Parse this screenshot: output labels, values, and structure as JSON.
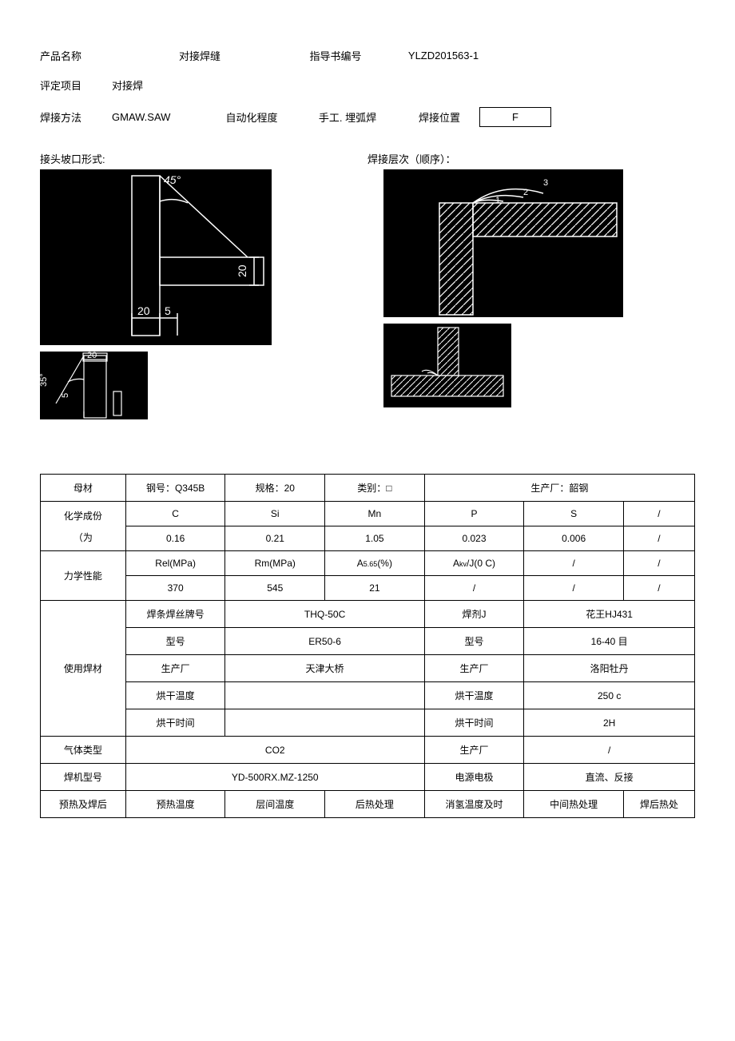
{
  "header": {
    "product_name_label": "产品名称",
    "product_name": "对接焊缝",
    "guide_no_label": "指导书编号",
    "guide_no": "YLZD201563-1",
    "eval_item_label": "评定项目",
    "eval_item": "对接焊",
    "weld_method_label": "焊接方法",
    "weld_method": "GMAW.SAW",
    "automation_label": "自动化程度",
    "automation": "手工. 埋弧焊",
    "weld_position_label": "焊接位置",
    "weld_position": "F"
  },
  "sections": {
    "groove_title": "接头坡口形式:",
    "layer_title": "焊接层次（顺序）："
  },
  "diagram_labels": {
    "angle45": "45°",
    "dim20v": "20",
    "dim20h": "20",
    "dim5": "5",
    "angle35": "35°",
    "small20": "20",
    "small5": "5",
    "pass3": "3",
    "pass2": "2",
    "pass1": "1"
  },
  "table": {
    "base_metal": "母材",
    "steel_grade_label": "钢号：",
    "steel_grade": "Q345B",
    "spec_label": "规格：",
    "spec": "20",
    "category_label": "类别：",
    "category": "□",
    "producer_label_full": "生产厂：韶钢",
    "chem_label": "化学成份",
    "chem_note": "（为",
    "C": "C",
    "Si": "Si",
    "Mn": "Mn",
    "P": "P",
    "S": "S",
    "slash": "/",
    "C_v": "0.16",
    "Si_v": "0.21",
    "Mn_v": "1.05",
    "P_v": "0.023",
    "S_v": "0.006",
    "mech_label": "力学性能",
    "Rel": "Rel(MPa)",
    "Rm": "Rm(MPa)",
    "A": "A",
    "A_sub": "5.65",
    "A_pct": "(%)",
    "Akv": "A",
    "Akv_sub": "kv",
    "Akv_suffix": "/J(0 C)",
    "Rel_v": "370",
    "Rm_v": "545",
    "A_v": "21",
    "material_label": "使用焊材",
    "wire_brand_label": "焊条焊丝牌号",
    "wire_brand": "THQ-50C",
    "flux_label": "焊剂J",
    "flux_brand": "花王HJ431",
    "model_label": "型号",
    "wire_model": "ER50-6",
    "flux_model": "16-40 目",
    "producer_label": "生产厂",
    "wire_producer": "天津大桥",
    "flux_producer": "洛阳牡丹",
    "dry_temp_label": "烘干温度",
    "flux_dry_temp": "250 c",
    "dry_time_label": "烘干时间",
    "flux_dry_time": "2H",
    "gas_type_label": "气体类型",
    "gas_type": "CO2",
    "gas_producer_label": "生产厂",
    "gas_producer": "/",
    "machine_label": "焊机型号",
    "machine": "YD-500RX.MZ-1250",
    "electrode_label": "电源电极",
    "electrode": "直流、反接",
    "postheat_row_label": "预热及焊后",
    "preheat_temp": "预热温度",
    "interpass_temp": "层间温度",
    "post_heat": "后热处理",
    "dehydro": "消氢温度及时",
    "mid_heat": "中间热处理",
    "pwht": "焊后热处"
  }
}
